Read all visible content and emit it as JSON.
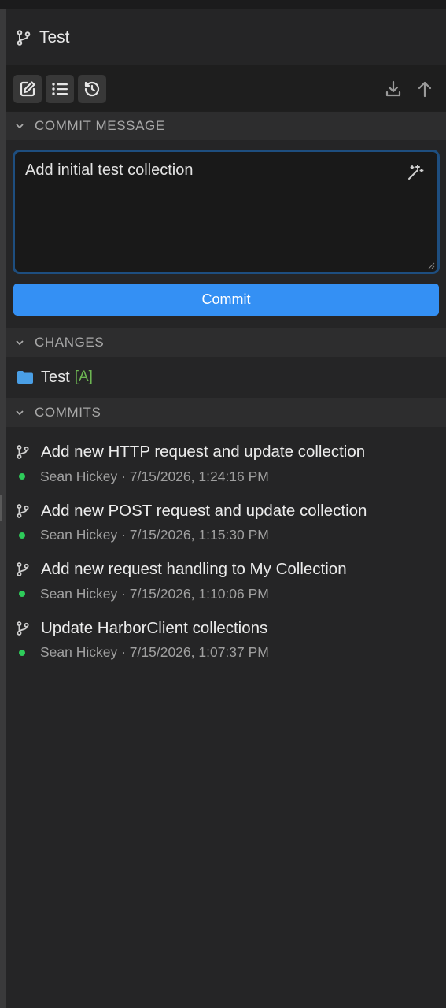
{
  "branch": {
    "name": "Test",
    "icon": "git-branch-icon"
  },
  "toolbar": {
    "left_icons": [
      "edit-icon",
      "list-icon",
      "history-icon"
    ],
    "right_icons": [
      "pull-icon",
      "push-icon"
    ]
  },
  "commit_section": {
    "title": "COMMIT MESSAGE",
    "message": "Add initial test collection",
    "button_label": "Commit",
    "accent_color": "#3490f4"
  },
  "changes_section": {
    "title": "CHANGES",
    "items": [
      {
        "name": "Test",
        "status": "[A]",
        "icon": "folder-icon"
      }
    ]
  },
  "commits_section": {
    "title": "COMMITS",
    "items": [
      {
        "message": "Add new HTTP request and update collection",
        "meta": "Sean Hickey · 7/15/2026, 1:24:16 PM"
      },
      {
        "message": "Add new POST request and update collection",
        "meta": "Sean Hickey · 7/15/2026, 1:15:30 PM"
      },
      {
        "message": "Add new request handling to My Collection",
        "meta": "Sean Hickey · 7/15/2026, 1:10:06 PM"
      },
      {
        "message": "Update HarborClient collections",
        "meta": "Sean Hickey · 7/15/2026, 1:07:37 PM"
      }
    ]
  }
}
